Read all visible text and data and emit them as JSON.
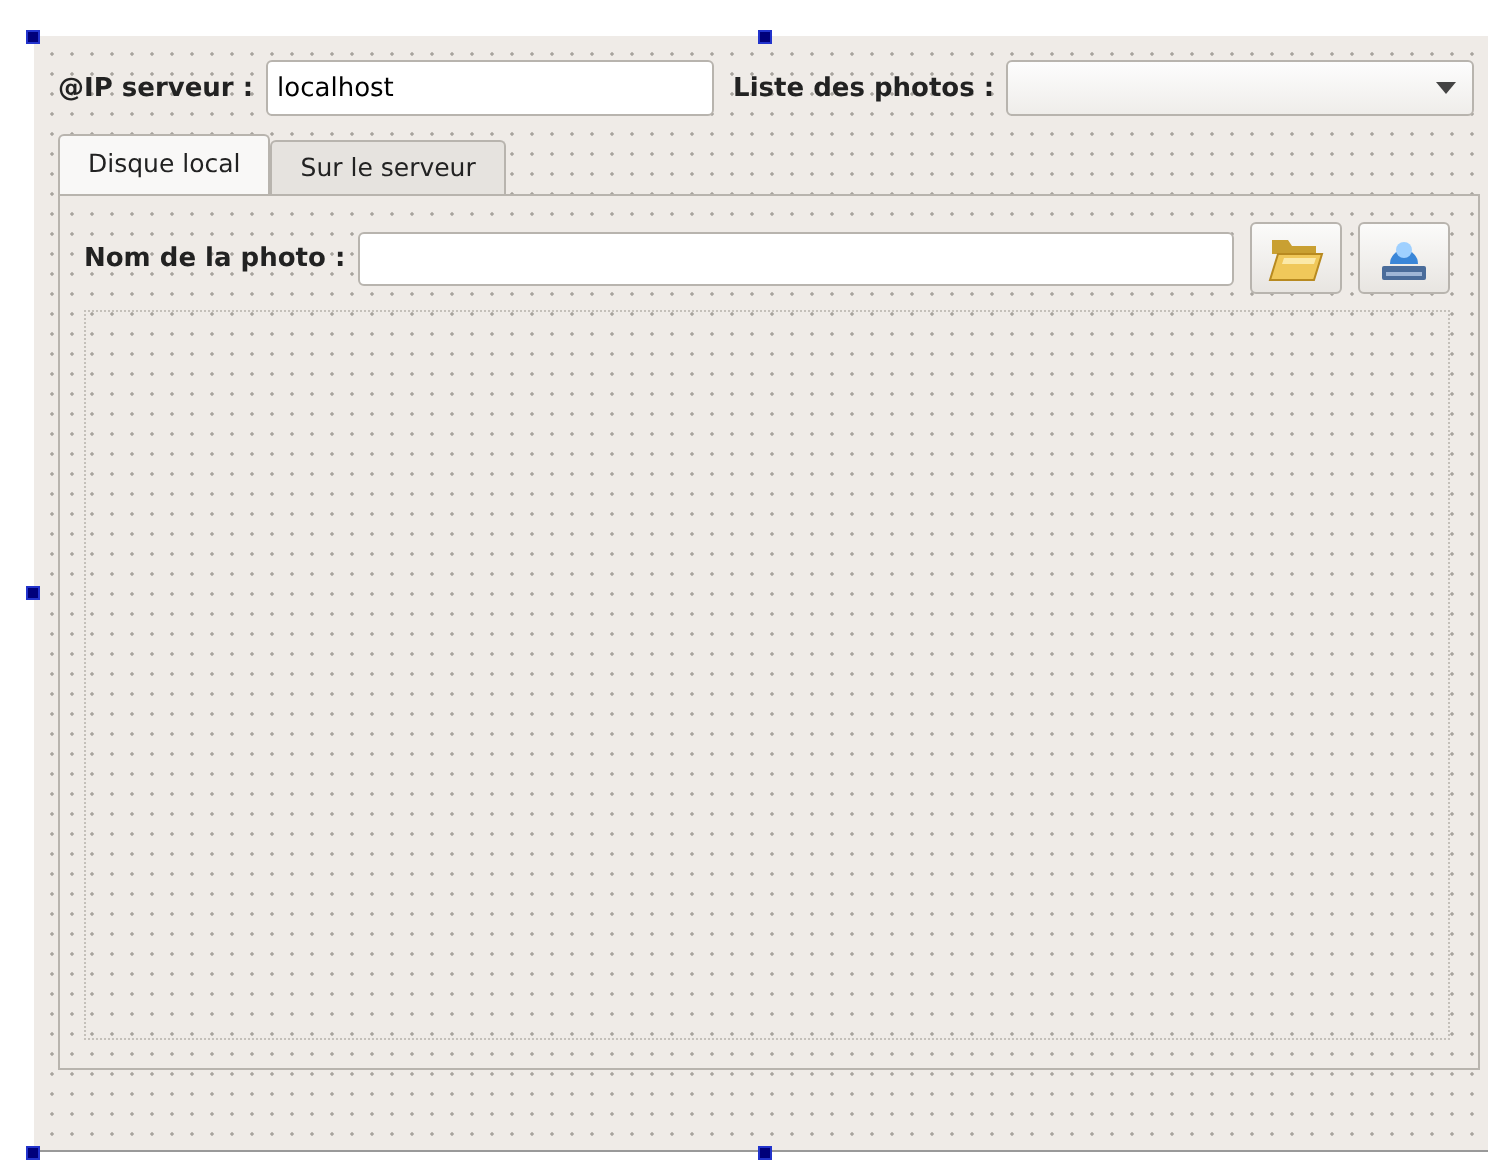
{
  "form": {
    "server_label": "@IP serveur :",
    "server_field": {
      "value": "localhost"
    },
    "photos_label": "Liste des photos :",
    "tabs": [
      {
        "label": "Disque local",
        "selected": true
      },
      {
        "label": "Sur le serveur",
        "selected": false
      }
    ],
    "photo_name_label": "Nom de la photo :"
  }
}
